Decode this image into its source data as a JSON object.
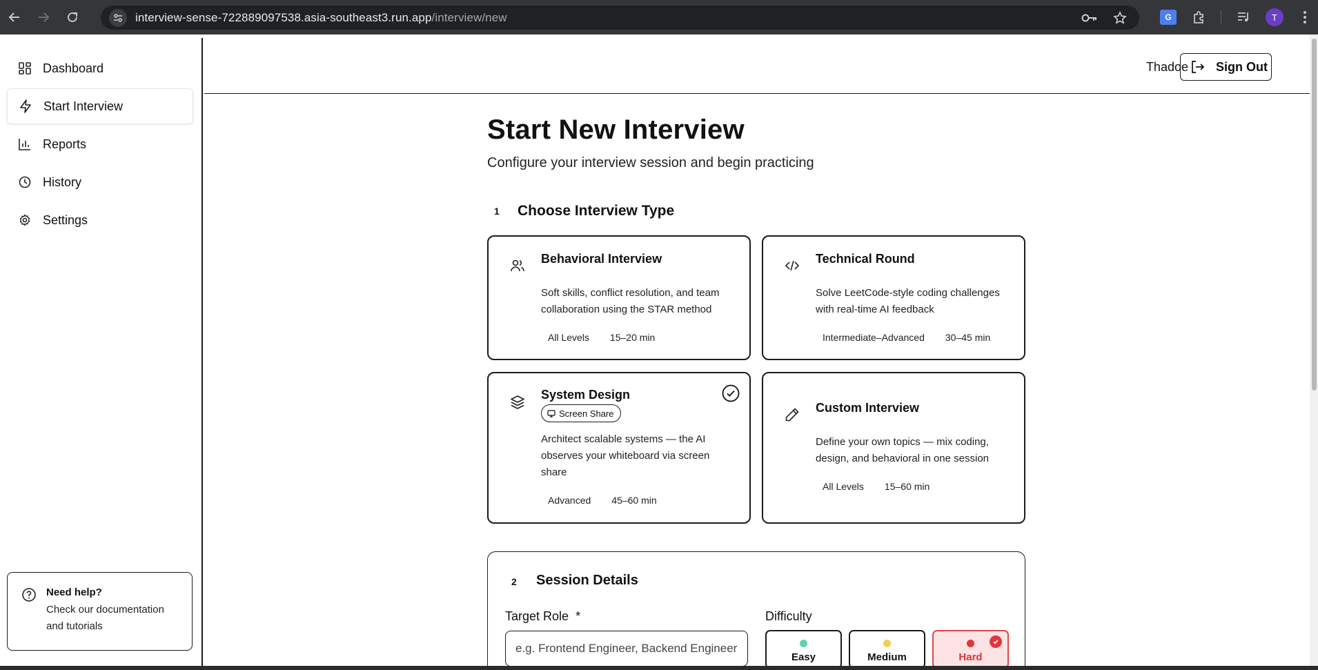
{
  "browser": {
    "url_host": "interview-sense-722889097538.asia-southeast3.run.app",
    "url_path": "/interview/new",
    "translate_label": "G",
    "profile_initial": "T"
  },
  "sidebar": {
    "items": [
      {
        "label": "Dashboard",
        "icon": "dashboard-icon"
      },
      {
        "label": "Start Interview",
        "icon": "lightning-icon",
        "active": true
      },
      {
        "label": "Reports",
        "icon": "bar-chart-icon"
      },
      {
        "label": "History",
        "icon": "clock-icon"
      },
      {
        "label": "Settings",
        "icon": "gear-icon"
      }
    ],
    "help": {
      "title": "Need help?",
      "text": "Check our documentation and tutorials"
    }
  },
  "header": {
    "user_name": "Thadoe",
    "signout_label": "Sign Out"
  },
  "main": {
    "title": "Start New Interview",
    "subtitle": "Configure your interview session and begin practicing",
    "step1": {
      "number": "1",
      "title": "Choose Interview Type"
    },
    "cards": [
      {
        "title": "Behavioral Interview",
        "description": "Soft skills, conflict resolution, and team collaboration using the STAR method",
        "level": "All Levels",
        "duration": "15–20 min",
        "icon": "users-icon"
      },
      {
        "title": "Technical Round",
        "description": "Solve LeetCode-style coding challenges with real-time AI feedback",
        "level": "Intermediate–Advanced",
        "duration": "30–45 min",
        "icon": "code-icon"
      },
      {
        "title": "System Design",
        "badge": "Screen Share",
        "description": "Architect scalable systems — the AI observes your whiteboard via screen share",
        "level": "Advanced",
        "duration": "45–60 min",
        "icon": "layers-icon",
        "selected": true
      },
      {
        "title": "Custom Interview",
        "description": "Define your own topics — mix coding, design, and behavioral in one session",
        "level": "All Levels",
        "duration": "15–60 min",
        "icon": "pencil-icon"
      }
    ],
    "step2": {
      "number": "2",
      "title": "Session Details"
    },
    "target_role": {
      "label": "Target Role",
      "required_mark": "*",
      "placeholder": "e.g. Frontend Engineer, Backend Engineer"
    },
    "difficulty": {
      "label": "Difficulty",
      "options": [
        {
          "label": "Easy",
          "color": "#5fd3a6"
        },
        {
          "label": "Medium",
          "color": "#f2cf57"
        },
        {
          "label": "Hard",
          "color": "#e2353f",
          "selected": true
        }
      ]
    }
  }
}
